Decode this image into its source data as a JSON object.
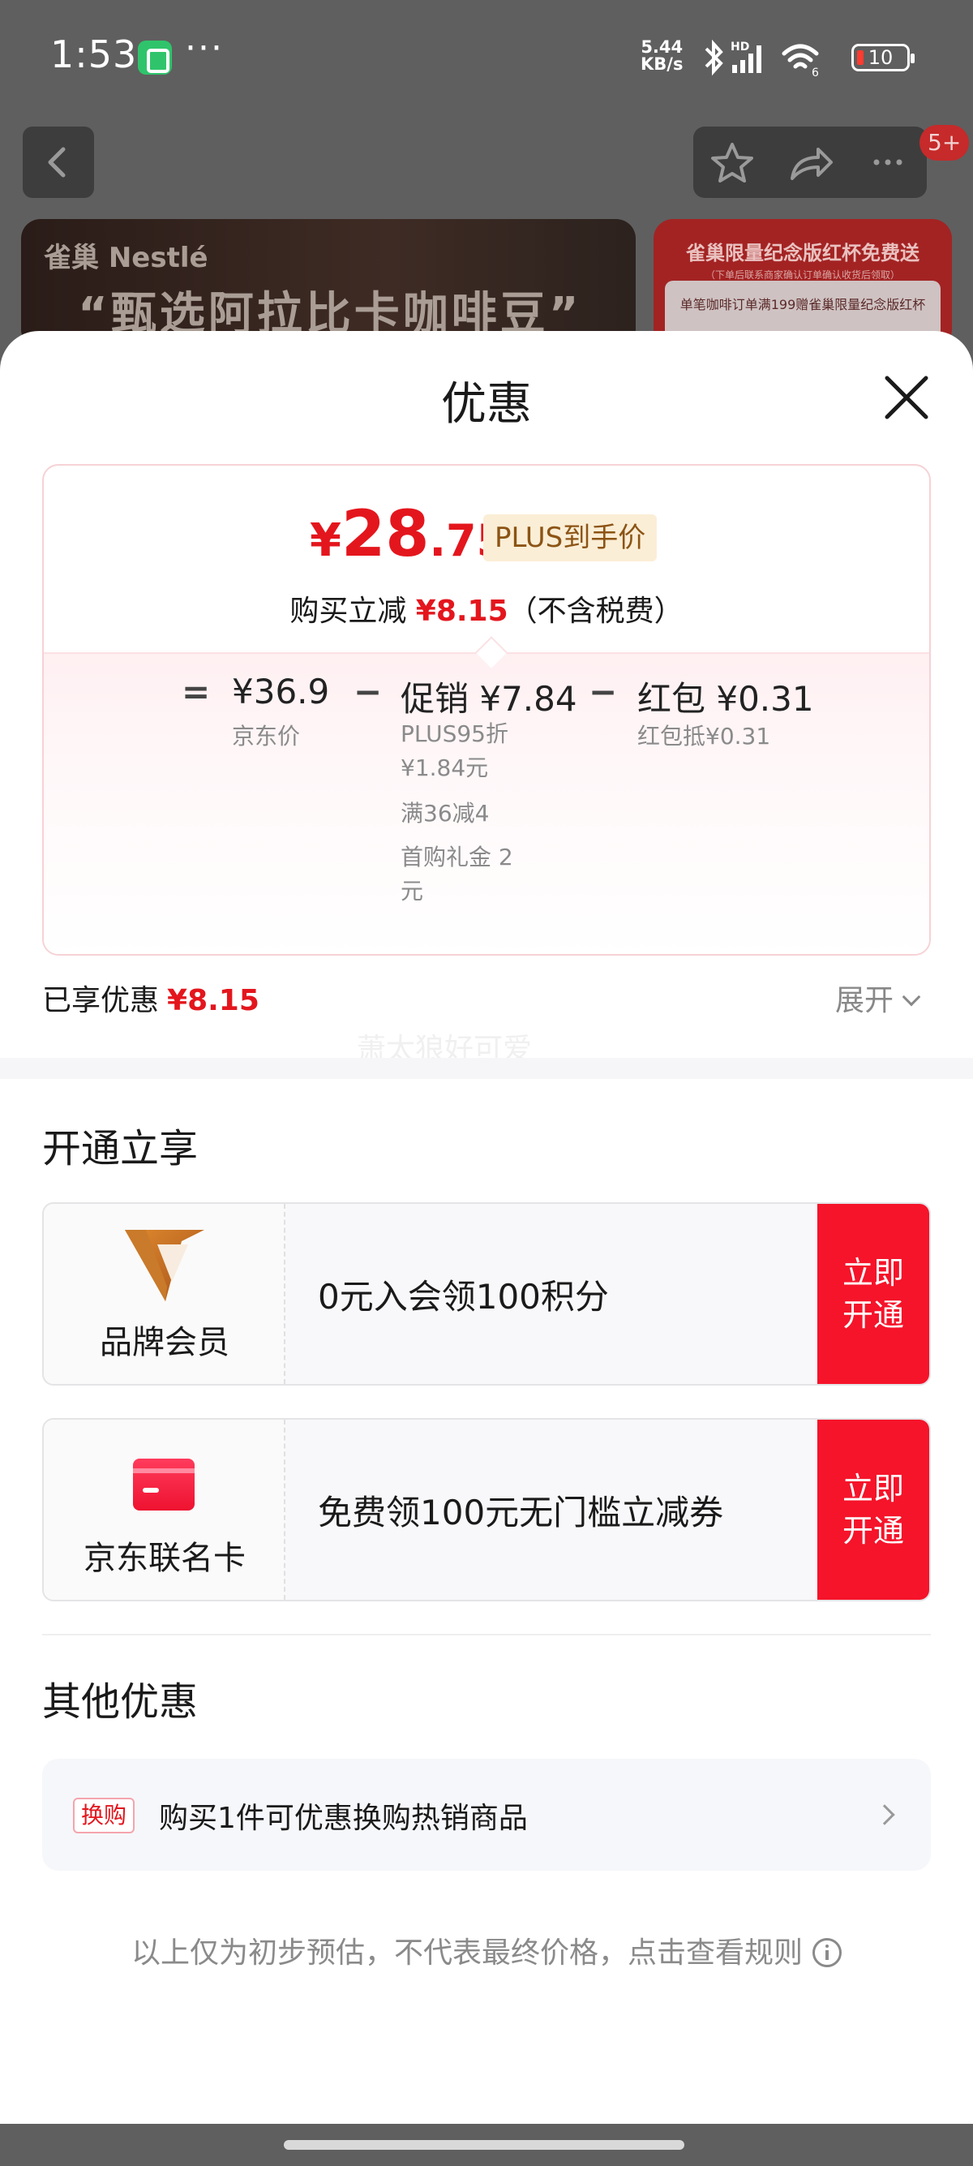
{
  "status_bar": {
    "time": "1:53",
    "more": "···",
    "net_speed_value": "5.44",
    "net_speed_unit": "KB/s",
    "battery": "10",
    "icons": [
      "app-icon",
      "bluetooth-icon",
      "signal-icon",
      "wifi-icon",
      "battery-icon"
    ]
  },
  "background": {
    "badge": "5+",
    "brand": "雀巢 Nestlé",
    "slogan": "“甄选阿拉比卡咖啡豆”",
    "promo_title": "雀巢限量纪念版红杯免费送",
    "promo_sub": "（下单后联系商家确认订单确认收货后领取）",
    "promo_text": "单笔咖啡订单满199赠雀巢限量纪念版红杯"
  },
  "sheet": {
    "title": "优惠",
    "price": {
      "symbol": "¥",
      "integer": "28",
      "decimal": ".75",
      "tag": "PLUS到手价",
      "reduce_prefix": "购买立减",
      "reduce_amount": "¥8.15",
      "reduce_suffix": "（不含税费）"
    },
    "breakdown": {
      "eq": "=",
      "minus": "−",
      "base_value": "¥36.9",
      "base_label": "京东价",
      "promo_value": "促销 ¥7.84",
      "promo_items": [
        "PLUS95折 ¥1.84元",
        "满36减4",
        "首购礼金 2元"
      ],
      "redpack_value": "红包 ¥0.31",
      "redpack_label": "红包抵¥0.31"
    },
    "enjoyed_label": "已享优惠",
    "enjoyed_amount": "¥8.15",
    "expand_label": "展开",
    "watermark": "萧太狼好可爱",
    "open_section_title": "开通立享",
    "memberships": [
      {
        "name": "品牌会员",
        "desc": "0元入会领100积分",
        "button": "立即开通",
        "icon": "brand-logo-icon"
      },
      {
        "name": "京东联名卡",
        "desc": "免费领100元无门槛立减券",
        "button": "立即开通",
        "icon": "credit-card-icon"
      }
    ],
    "other_section_title": "其他优惠",
    "other_offer": {
      "tag": "换购",
      "text": "购买1件可优惠换购热销商品"
    },
    "footnote": "以上仅为初步预估，不代表最终价格，点击查看规则"
  },
  "colors": {
    "accent_red": "#e4161d",
    "button_red": "#f5142a",
    "plus_tag_bg": "#fbeed6",
    "plus_tag_text": "#8c5415",
    "brand_orange": "#c56a1e"
  }
}
